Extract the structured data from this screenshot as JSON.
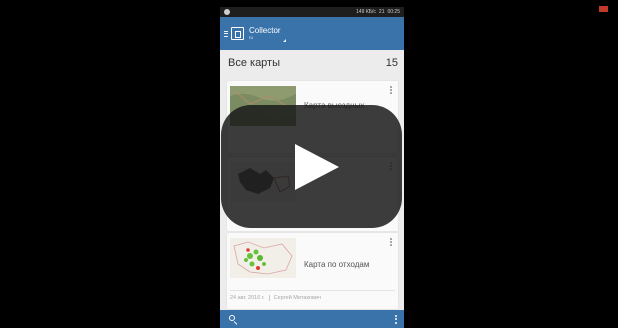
{
  "statusbar": {
    "net_speed": "149 КБ/с",
    "battery": "21",
    "time": "00:25"
  },
  "appbar": {
    "title": "Collector",
    "subtitle": "ru"
  },
  "list": {
    "label": "Все карты",
    "count": "15"
  },
  "cards": [
    {
      "name": "Карта выездных"
    },
    {
      "name": ""
    },
    {
      "name": "Карта по отходам",
      "date": "24 авг. 2016 г.",
      "author": "Сергей Митакович"
    }
  ],
  "icons": {
    "search": "search-icon",
    "more": "more-vert-icon",
    "play": "play-icon"
  },
  "colors": {
    "appbar": "#3a73aa",
    "background": "#000000",
    "card_bg": "#fafafa"
  }
}
